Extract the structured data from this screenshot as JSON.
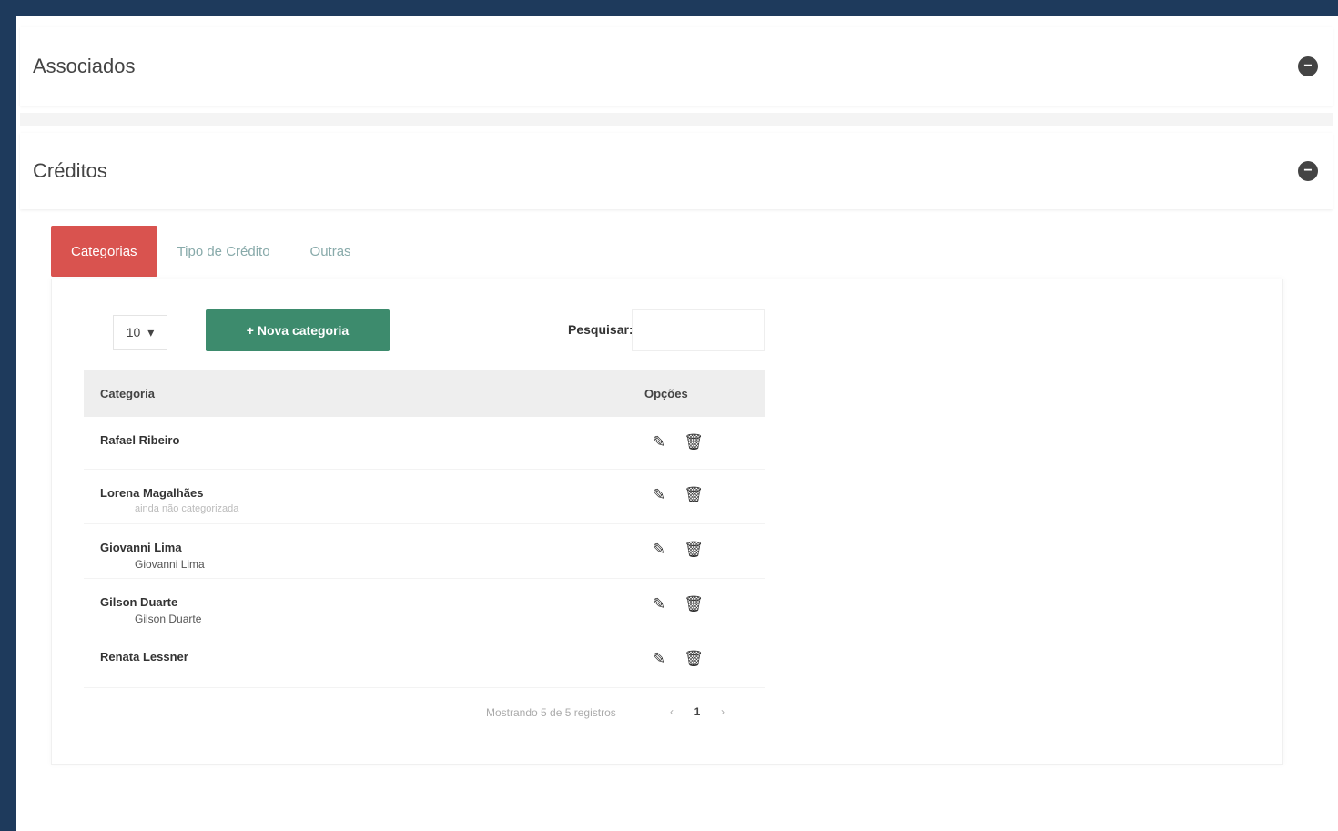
{
  "panels": {
    "associados": {
      "title": "Associados",
      "toggle": "−"
    },
    "creditos": {
      "title": "Créditos",
      "toggle": "−"
    }
  },
  "tabs": [
    {
      "label": "Categorias",
      "active": true
    },
    {
      "label": "Tipo de Crédito",
      "active": false
    },
    {
      "label": "Outras",
      "active": false
    }
  ],
  "toolbar": {
    "page_length": "10",
    "new_button_label": "+ Nova categoria",
    "search_label": "Pesquisar:",
    "search_value": ""
  },
  "table": {
    "columns": [
      "Categoria",
      "Opções"
    ],
    "rows": [
      {
        "name": "Rafael Ribeiro",
        "sub": ""
      },
      {
        "name": "Lorena Magalhães",
        "sub": "ainda não categorizada"
      },
      {
        "name": "Giovanni Lima",
        "sub": "Giovanni Lima"
      },
      {
        "name": "Gilson Duarte",
        "sub": "Gilson Duarte"
      },
      {
        "name": "Renata Lessner",
        "sub": ""
      }
    ]
  },
  "pagination": {
    "info": "Mostrando 5 de 5 registros",
    "prev": "‹",
    "pages": [
      "1"
    ],
    "next": "›",
    "current": "1"
  },
  "icons": {
    "edit": "edit-icon",
    "delete": "trash-icon"
  },
  "colors": {
    "frame_border": "#1e3a5c",
    "active_tab": "#d9534f",
    "primary_button": "#3d8b6d"
  }
}
